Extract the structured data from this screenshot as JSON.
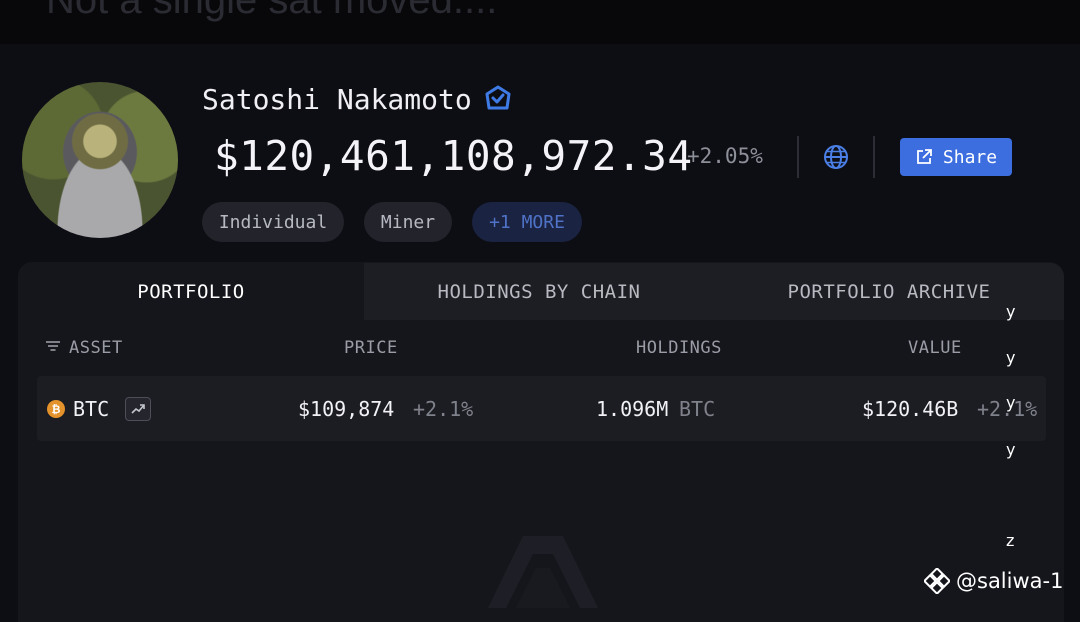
{
  "top_banner": {
    "text": "Not a single sat moved...."
  },
  "profile": {
    "name": "Satoshi Nakamoto",
    "verified_icon": "verified-badge-icon",
    "balance": "$120,461,108,972.34",
    "change": "+2.05%",
    "globe_icon": "globe-icon",
    "share_label": "Share",
    "tags": [
      "Individual",
      "Miner",
      "+1 MORE"
    ]
  },
  "tabs": [
    {
      "label": "PORTFOLIO",
      "active": true
    },
    {
      "label": "HOLDINGS BY CHAIN",
      "active": false
    },
    {
      "label": "PORTFOLIO ARCHIVE",
      "active": false
    }
  ],
  "table": {
    "headers": {
      "asset": "ASSET",
      "price": "PRICE",
      "holdings": "HOLDINGS",
      "value": "VALUE"
    },
    "rows": [
      {
        "asset": "BTC",
        "price": "$109,874",
        "price_change": "+2.1%",
        "holdings_amount": "1.096M",
        "holdings_unit": "BTC",
        "value": "$120.46B",
        "value_change": "+2.1%"
      }
    ]
  },
  "stray_letters": [
    "y",
    "y",
    "y",
    "y",
    "z"
  ],
  "credit": {
    "handle": "@saliwa-1"
  },
  "colors": {
    "background": "#0d0e14",
    "panel": "#15161c",
    "accent_blue": "#3c6ee0",
    "btc_orange": "#e4922b",
    "muted": "#8d8f99"
  }
}
